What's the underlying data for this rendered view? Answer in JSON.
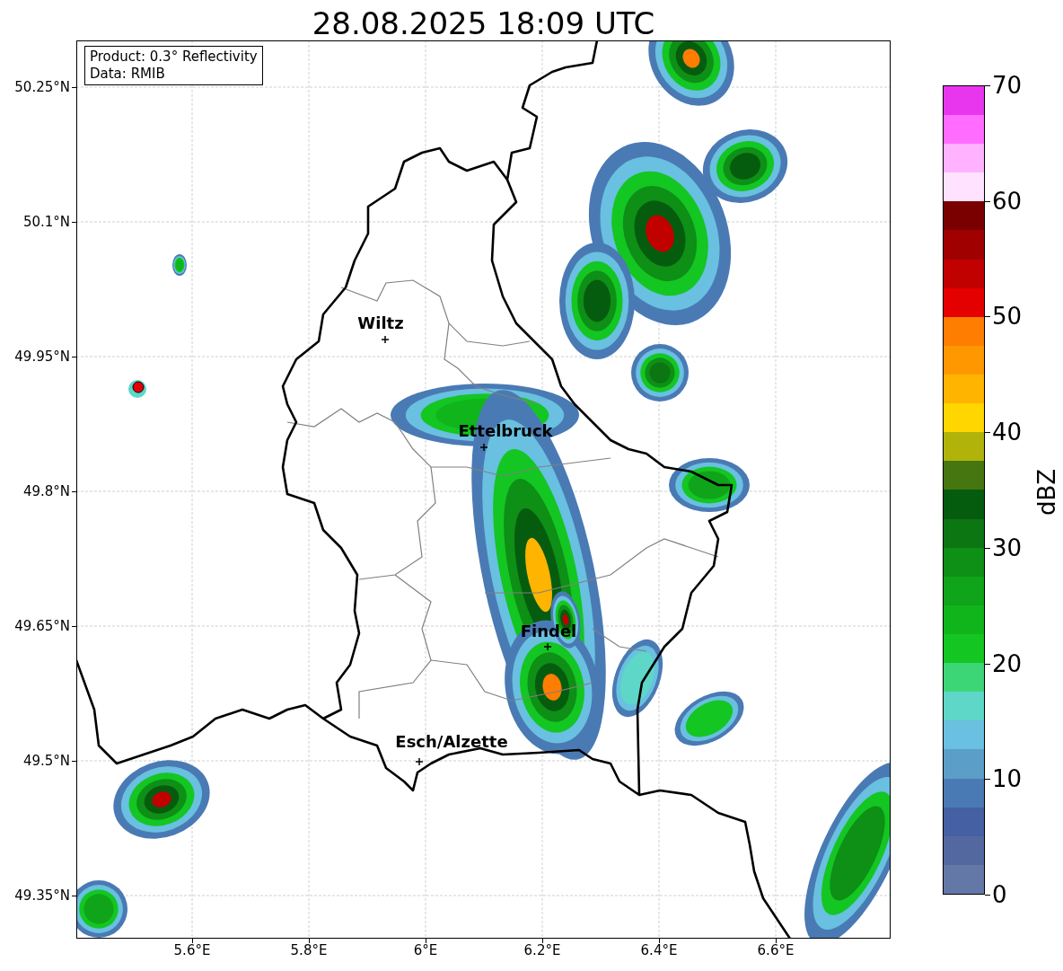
{
  "title": "28.08.2025 18:09 UTC",
  "info_box": [
    "Product: 0.3° Reflectivity",
    "Data: RMIB"
  ],
  "places": [
    {
      "name": "Wiltz"
    },
    {
      "name": "Ettelbruck"
    },
    {
      "name": "Findel"
    },
    {
      "name": "Esch/Alzette"
    }
  ],
  "lat_ticks": [
    "50.25°N",
    "50.1°N",
    "49.95°N",
    "49.8°N",
    "49.65°N",
    "49.5°N",
    "49.35°N"
  ],
  "lon_ticks": [
    "5.6°E",
    "5.8°E",
    "6°E",
    "6.2°E",
    "6.4°E",
    "6.6°E"
  ],
  "colorbar": {
    "label": "dBZ",
    "ticks": [
      "70",
      "60",
      "50",
      "40",
      "30",
      "20",
      "10",
      "0"
    ],
    "bins": [
      {
        "color": "#6478a8"
      },
      {
        "color": "#5468a0"
      },
      {
        "color": "#4560a3"
      },
      {
        "color": "#4a7ab4"
      },
      {
        "color": "#5b9ec8"
      },
      {
        "color": "#69c0e0"
      },
      {
        "color": "#5ed6c8"
      },
      {
        "color": "#3dd677"
      },
      {
        "color": "#13c622"
      },
      {
        "color": "#10b51c"
      },
      {
        "color": "#10a41a"
      },
      {
        "color": "#0e8f16"
      },
      {
        "color": "#0b7612"
      },
      {
        "color": "#055c0e"
      },
      {
        "color": "#467610"
      },
      {
        "color": "#b1b30a"
      },
      {
        "color": "#ffd600"
      },
      {
        "color": "#ffb400"
      },
      {
        "color": "#ff9800"
      },
      {
        "color": "#ff7d00"
      },
      {
        "color": "#e50000"
      },
      {
        "color": "#c10000"
      },
      {
        "color": "#a10000"
      },
      {
        "color": "#7a0000"
      },
      {
        "color": "#ffe2ff"
      },
      {
        "color": "#ffb2ff"
      },
      {
        "color": "#ff6cff"
      },
      {
        "color": "#e836ef"
      }
    ]
  }
}
